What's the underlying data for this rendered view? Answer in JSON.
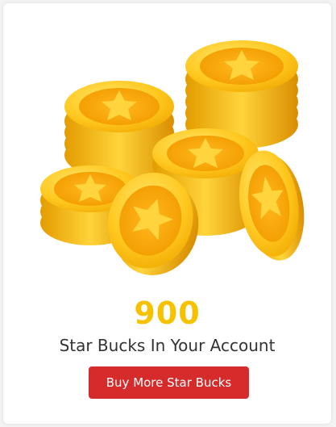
{
  "balance": {
    "amount": "900",
    "label": "Star Bucks In Your Account"
  },
  "actions": {
    "buy_label": "Buy More Star Bucks"
  },
  "colors": {
    "amount": "#f6c200",
    "button": "#d52b2b",
    "coin_gold": "#f5b800"
  },
  "illustration": {
    "icon": "gold-star-coins-stack-icon"
  }
}
